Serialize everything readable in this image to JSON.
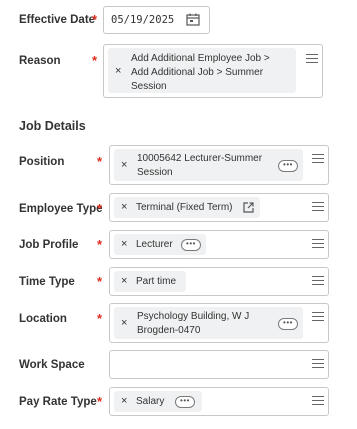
{
  "effective_date": {
    "label": "Effective Date",
    "value": "05/19/2025",
    "required_mark": "*"
  },
  "reason": {
    "label": "Reason",
    "line1": "Add Additional Employee Job >",
    "line2": "Add Additional Job > Summer",
    "line3": "Session",
    "required_mark": "*"
  },
  "job_details_heading": "Job Details",
  "position": {
    "label": "Position",
    "line1": "10005642 Lecturer-Summer",
    "line2": "Session",
    "more": "•••",
    "required_mark": "*"
  },
  "employee_type": {
    "label": "Employee Type",
    "value": "Terminal (Fixed Term)",
    "required_mark": "*"
  },
  "job_profile": {
    "label": "Job Profile",
    "value": "Lecturer",
    "more": "•••",
    "required_mark": "*"
  },
  "time_type": {
    "label": "Time Type",
    "value": "Part time",
    "required_mark": "*"
  },
  "location": {
    "label": "Location",
    "line1": "Psychology Building, W J",
    "line2": "Brogden-0470",
    "more": "•••",
    "required_mark": "*"
  },
  "work_space": {
    "label": "Work Space"
  },
  "pay_rate_type": {
    "label": "Pay Rate Type",
    "value": "Salary",
    "more": "•••",
    "required_mark": "*"
  },
  "remove_symbol": "×",
  "colors": {
    "required": "#de2c1e",
    "border": "#c8c8c8",
    "pill": "#f0f1f2"
  }
}
